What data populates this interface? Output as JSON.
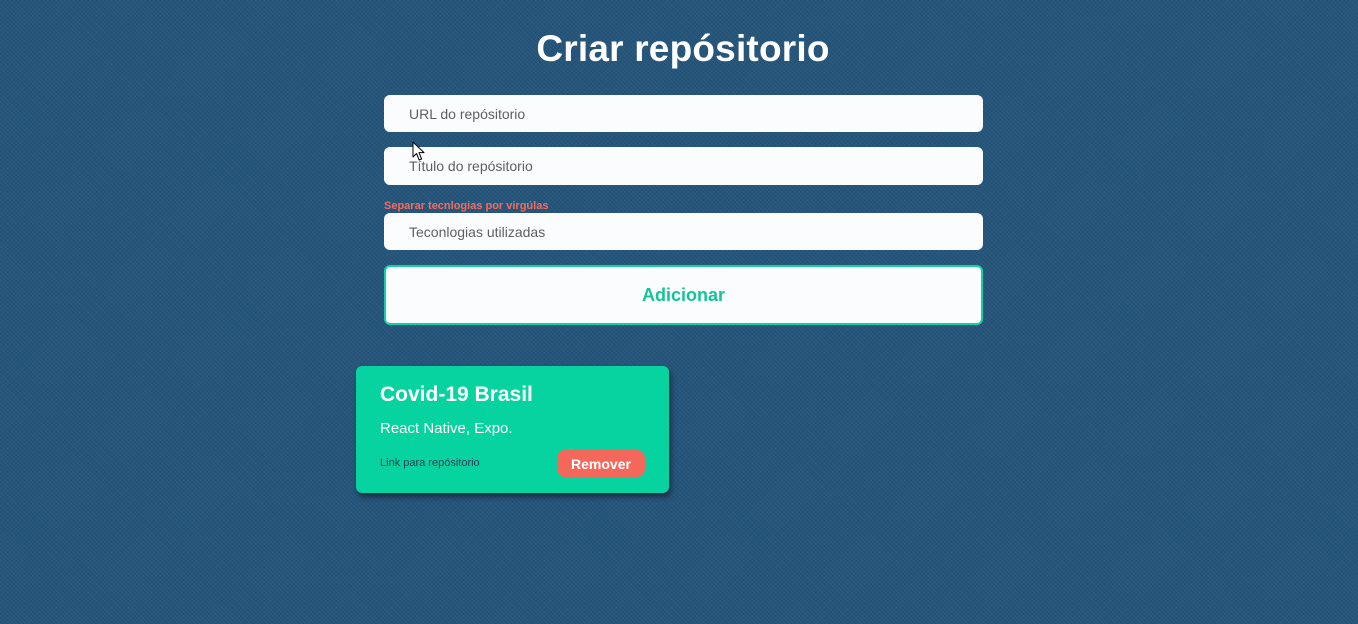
{
  "header": {
    "title": "Criar repósitorio"
  },
  "form": {
    "url_placeholder": "URL do repósitorio",
    "title_placeholder": "Título do repósitorio",
    "techs_hint": "Separar tecnlogias por virgúlas",
    "techs_placeholder": "Teconlogias utilizadas",
    "submit_label": "Adicionar"
  },
  "repositories": [
    {
      "title": "Covid-19 Brasil",
      "techs": "React Native, Expo.",
      "link_label": "Link para repósitorio",
      "remove_label": "Remover"
    }
  ],
  "colors": {
    "background": "#25557a",
    "accent": "#06d3a0",
    "danger": "#f4685c",
    "input_background": "#fbfcfe"
  },
  "icons": {
    "cursor": "mouse-pointer-icon"
  }
}
